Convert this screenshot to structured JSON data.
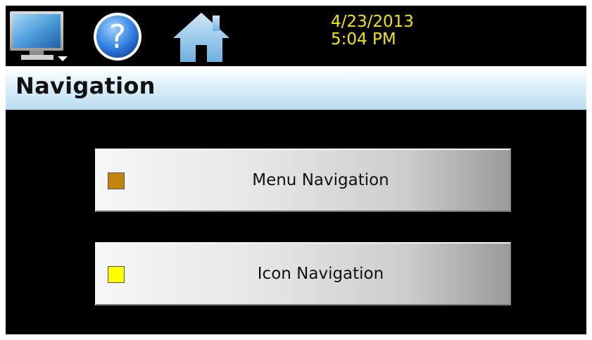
{
  "header": {
    "date": "4/23/2013",
    "time": "5:04 PM",
    "datetime_color": "#f2e600",
    "icons": [
      "monitor-icon",
      "help-icon",
      "home-icon"
    ]
  },
  "page": {
    "title": "Navigation"
  },
  "navigation": {
    "buttons": [
      {
        "label": "Menu Navigation",
        "swatch_color": "#c4860a",
        "icon": "orange-square-icon"
      },
      {
        "label": "Icon Navigation",
        "swatch_color": "#ffff00",
        "icon": "yellow-square-icon"
      }
    ]
  }
}
